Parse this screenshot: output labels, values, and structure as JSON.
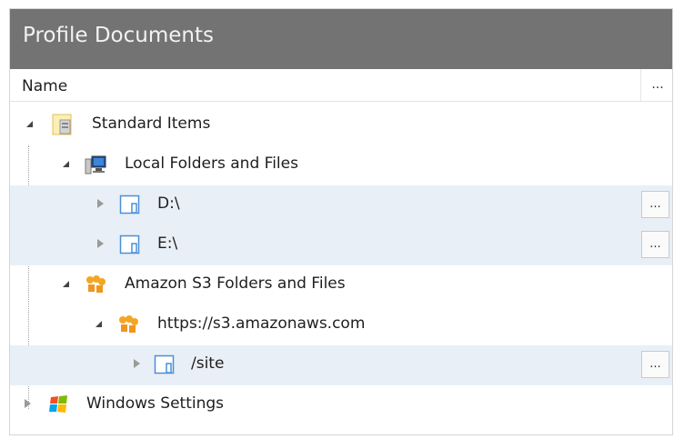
{
  "panel": {
    "title": "Profile Documents"
  },
  "columns": {
    "name": "Name",
    "more": "..."
  },
  "tree": [
    {
      "label": "Standard Items",
      "expanded": true,
      "icon": "standard-items-folder-icon"
    },
    {
      "label": "Local Folders and Files",
      "expanded": true,
      "icon": "computer-icon"
    },
    {
      "label": "D:\\",
      "expanded": false,
      "icon": "folder-icon",
      "action": "..."
    },
    {
      "label": "E:\\",
      "expanded": false,
      "icon": "folder-icon",
      "action": "..."
    },
    {
      "label": "Amazon S3 Folders and Files",
      "expanded": true,
      "icon": "amazon-s3-icon"
    },
    {
      "label": "https://s3.amazonaws.com",
      "expanded": true,
      "icon": "amazon-s3-icon"
    },
    {
      "label": "/site",
      "expanded": false,
      "icon": "folder-icon",
      "action": "..."
    },
    {
      "label": "Windows Settings",
      "expanded": false,
      "icon": "windows-logo-icon"
    }
  ],
  "colors": {
    "title_bar": "#737373",
    "selected_row": "#e9eff6",
    "s3_orange": "#f4a623"
  }
}
